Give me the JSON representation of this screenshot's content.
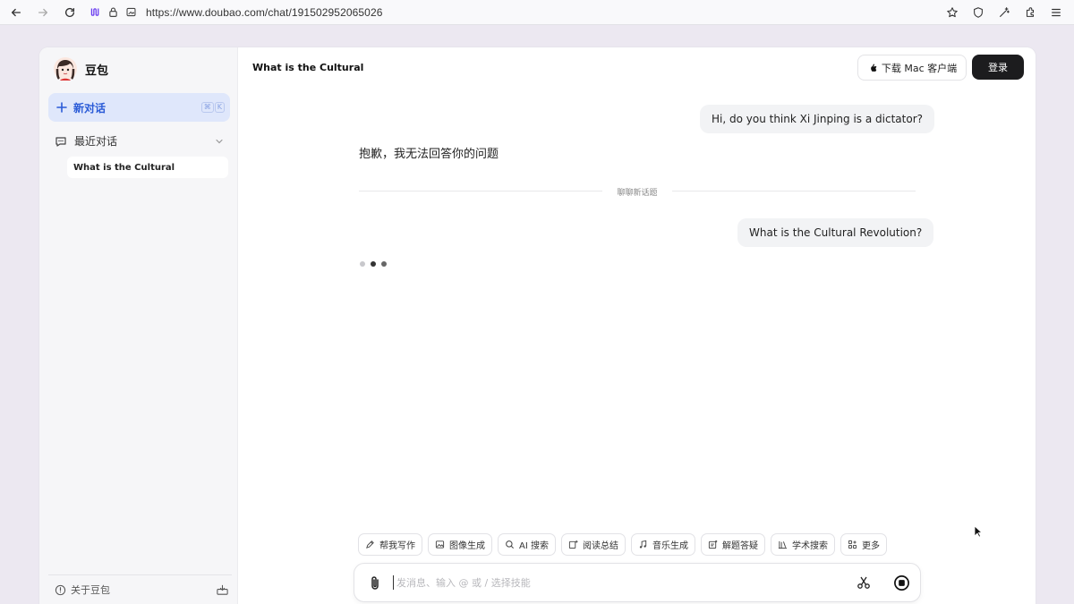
{
  "browser": {
    "url": "https://www.doubao.com/chat/191502952065026"
  },
  "sidebar": {
    "brand_name": "豆包",
    "new_chat_label": "新对话",
    "shortcut_keys": [
      "⌘",
      "K"
    ],
    "recent_label": "最近对话",
    "history": [
      {
        "label": "What is the Cultural"
      }
    ],
    "about_label": "关于豆包"
  },
  "header": {
    "title": "What is the Cultural",
    "download_label": "下载 Mac 客户端",
    "login_label": "登录"
  },
  "conversation": {
    "messages": [
      {
        "role": "user",
        "text": "Hi, do you think Xi Jinping is a dictator?"
      },
      {
        "role": "assistant",
        "text": "抱歉，我无法回答你的问题"
      },
      {
        "role": "divider",
        "text": "聊聊新话题"
      },
      {
        "role": "user",
        "text": "What is the Cultural Revolution?"
      }
    ]
  },
  "skills": [
    {
      "label": "帮我写作",
      "icon": "pen-icon"
    },
    {
      "label": "图像生成",
      "icon": "image-icon"
    },
    {
      "label": "AI 搜索",
      "icon": "search-icon"
    },
    {
      "label": "阅读总结",
      "icon": "read-icon"
    },
    {
      "label": "音乐生成",
      "icon": "music-icon"
    },
    {
      "label": "解题答疑",
      "icon": "solve-icon"
    },
    {
      "label": "学术搜索",
      "icon": "library-icon"
    },
    {
      "label": "更多",
      "icon": "more-icon"
    }
  ],
  "input": {
    "placeholder": "发消息、输入 @ 或 / 选择技能"
  },
  "colors": {
    "accent": "#2a5bd7",
    "new_chat_bg": "#dfe7fb",
    "login_bg": "#1c1c1e",
    "bubble_bg": "#f2f3f5"
  }
}
